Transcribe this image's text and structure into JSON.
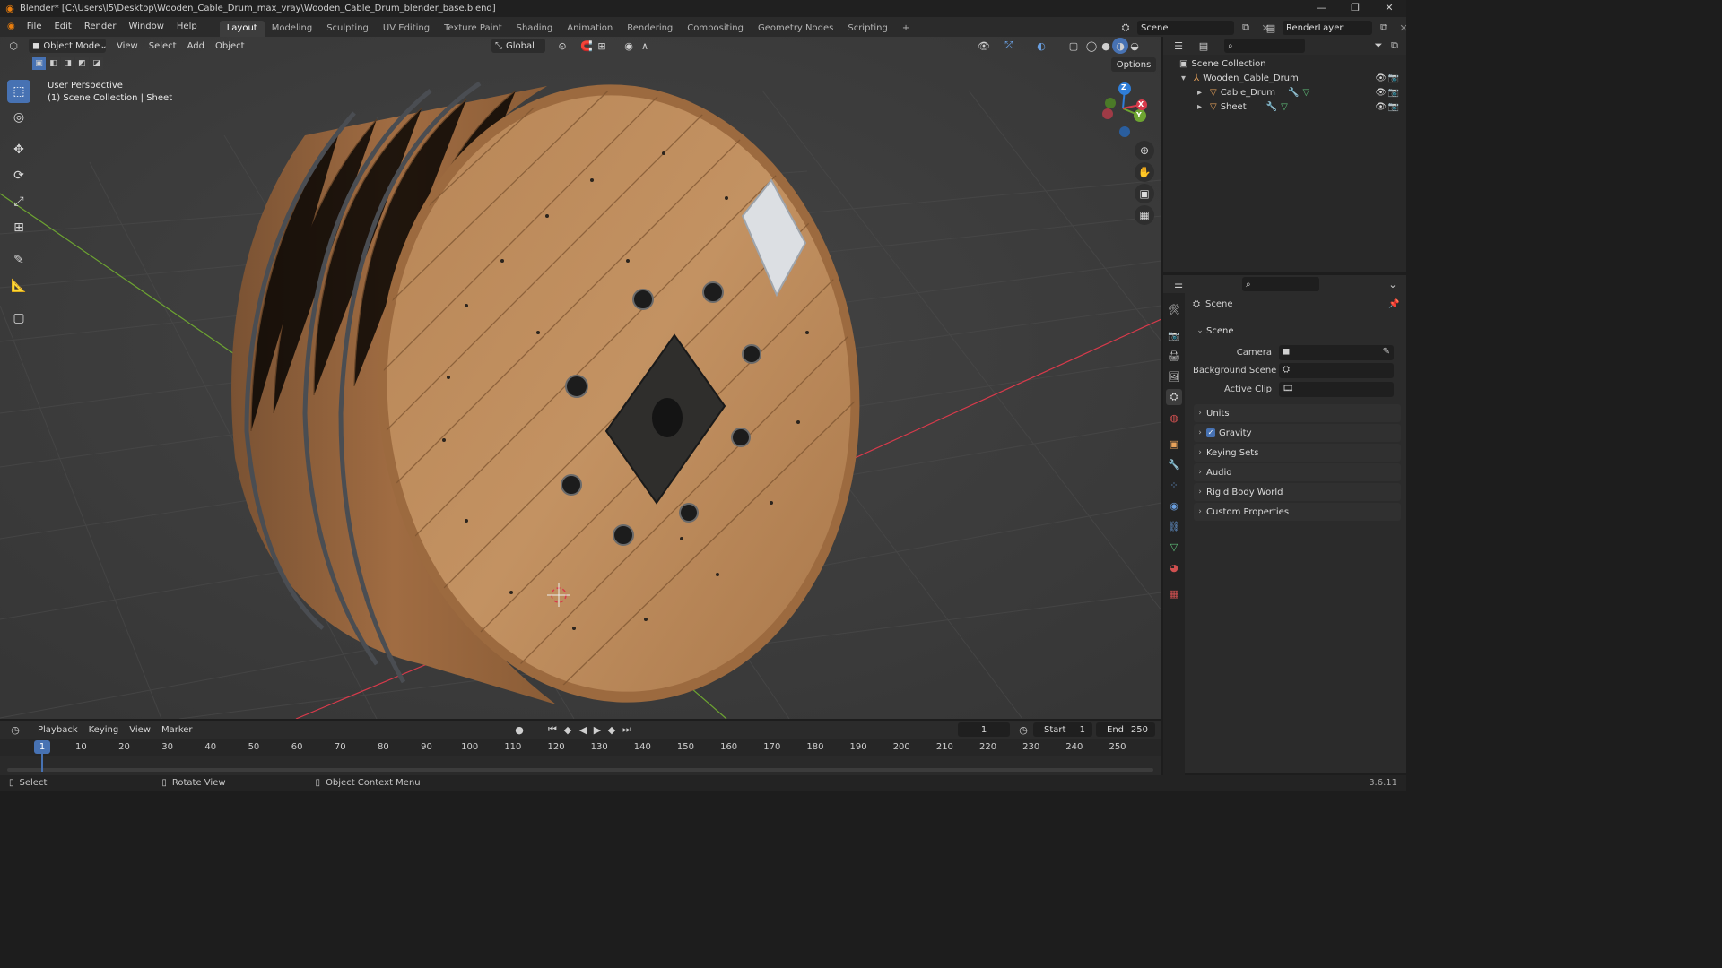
{
  "window": {
    "title": "Blender* [C:\\Users\\l5\\Desktop\\Wooden_Cable_Drum_max_vray\\Wooden_Cable_Drum_blender_base.blend]",
    "controls": [
      "—",
      "❐",
      "✕"
    ]
  },
  "menu": {
    "items": [
      "File",
      "Edit",
      "Render",
      "Window",
      "Help"
    ],
    "workspaces": [
      "Layout",
      "Modeling",
      "Sculpting",
      "UV Editing",
      "Texture Paint",
      "Shading",
      "Animation",
      "Rendering",
      "Compositing",
      "Geometry Nodes",
      "Scripting"
    ],
    "active_workspace": "Layout",
    "add_tab": "+",
    "scene": "Scene",
    "view_layer": "RenderLayer"
  },
  "viewport_header": {
    "mode": "Object Mode",
    "menus": [
      "View",
      "Select",
      "Add",
      "Object"
    ],
    "transform_orientation": "Global",
    "options": "Options"
  },
  "viewport": {
    "perspective": "User Perspective",
    "collection_info": "(1) Scene Collection | Sheet",
    "gizmo_axes": [
      "Z",
      "Y",
      "X"
    ]
  },
  "outliner": {
    "root": "Scene Collection",
    "items": [
      {
        "name": "Wooden_Cable_Drum",
        "level": 1
      },
      {
        "name": "Cable_Drum",
        "level": 2
      },
      {
        "name": "Sheet",
        "level": 2
      }
    ]
  },
  "properties": {
    "context": "Scene",
    "section": "Scene",
    "fields": [
      {
        "label": "Camera",
        "value": ""
      },
      {
        "label": "Background Scene",
        "value": ""
      },
      {
        "label": "Active Clip",
        "value": ""
      }
    ],
    "panels": [
      "Units",
      "Gravity",
      "Keying Sets",
      "Audio",
      "Rigid Body World",
      "Custom Properties"
    ],
    "gravity_checked": true
  },
  "timeline": {
    "menus": [
      "Playback",
      "Keying",
      "View",
      "Marker"
    ],
    "current_frame": "1",
    "start_label": "Start",
    "start": "1",
    "end_label": "End",
    "end": "250",
    "ticks": [
      "1",
      "10",
      "20",
      "30",
      "40",
      "50",
      "60",
      "70",
      "80",
      "90",
      "100",
      "110",
      "120",
      "130",
      "140",
      "150",
      "160",
      "170",
      "180",
      "190",
      "200",
      "210",
      "220",
      "230",
      "240",
      "250"
    ]
  },
  "statusbar": {
    "select": "Select",
    "rotate": "Rotate View",
    "context_menu": "Object Context Menu",
    "version": "3.6.11"
  },
  "colors": {
    "accent": "#4772b3",
    "wood": "#b07a48",
    "axis_x": "#d83a4b",
    "axis_y": "#6da431",
    "axis_z": "#2f7ed8"
  }
}
